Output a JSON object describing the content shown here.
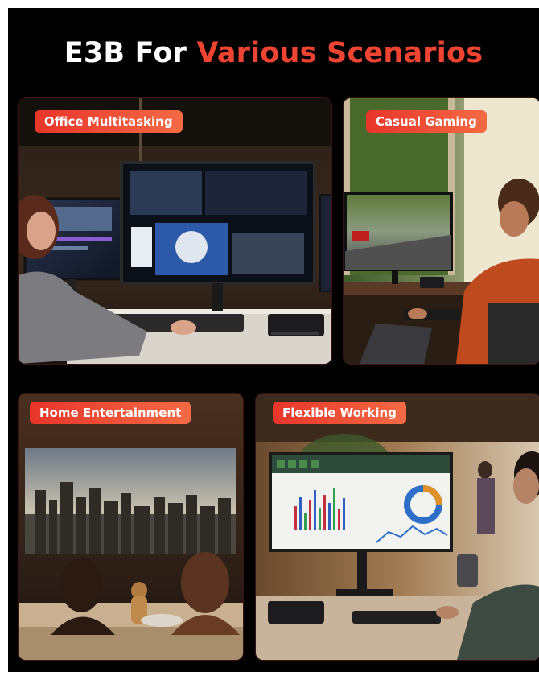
{
  "headline": {
    "prefix": "E3B For",
    "accent": "Various Scenarios",
    "accent_color": "#f04433"
  },
  "scenarios": [
    {
      "label": "Office Multitasking",
      "icon": "office-desk-scene"
    },
    {
      "label": "Casual Gaming",
      "icon": "gaming-desk-scene"
    },
    {
      "label": "Home Entertainment",
      "icon": "living-room-projection-scene"
    },
    {
      "label": "Flexible Working",
      "icon": "workspace-dashboard-scene"
    }
  ],
  "colors": {
    "background": "#000000",
    "badge_start": "#e8352a",
    "badge_end": "#f46a44"
  }
}
